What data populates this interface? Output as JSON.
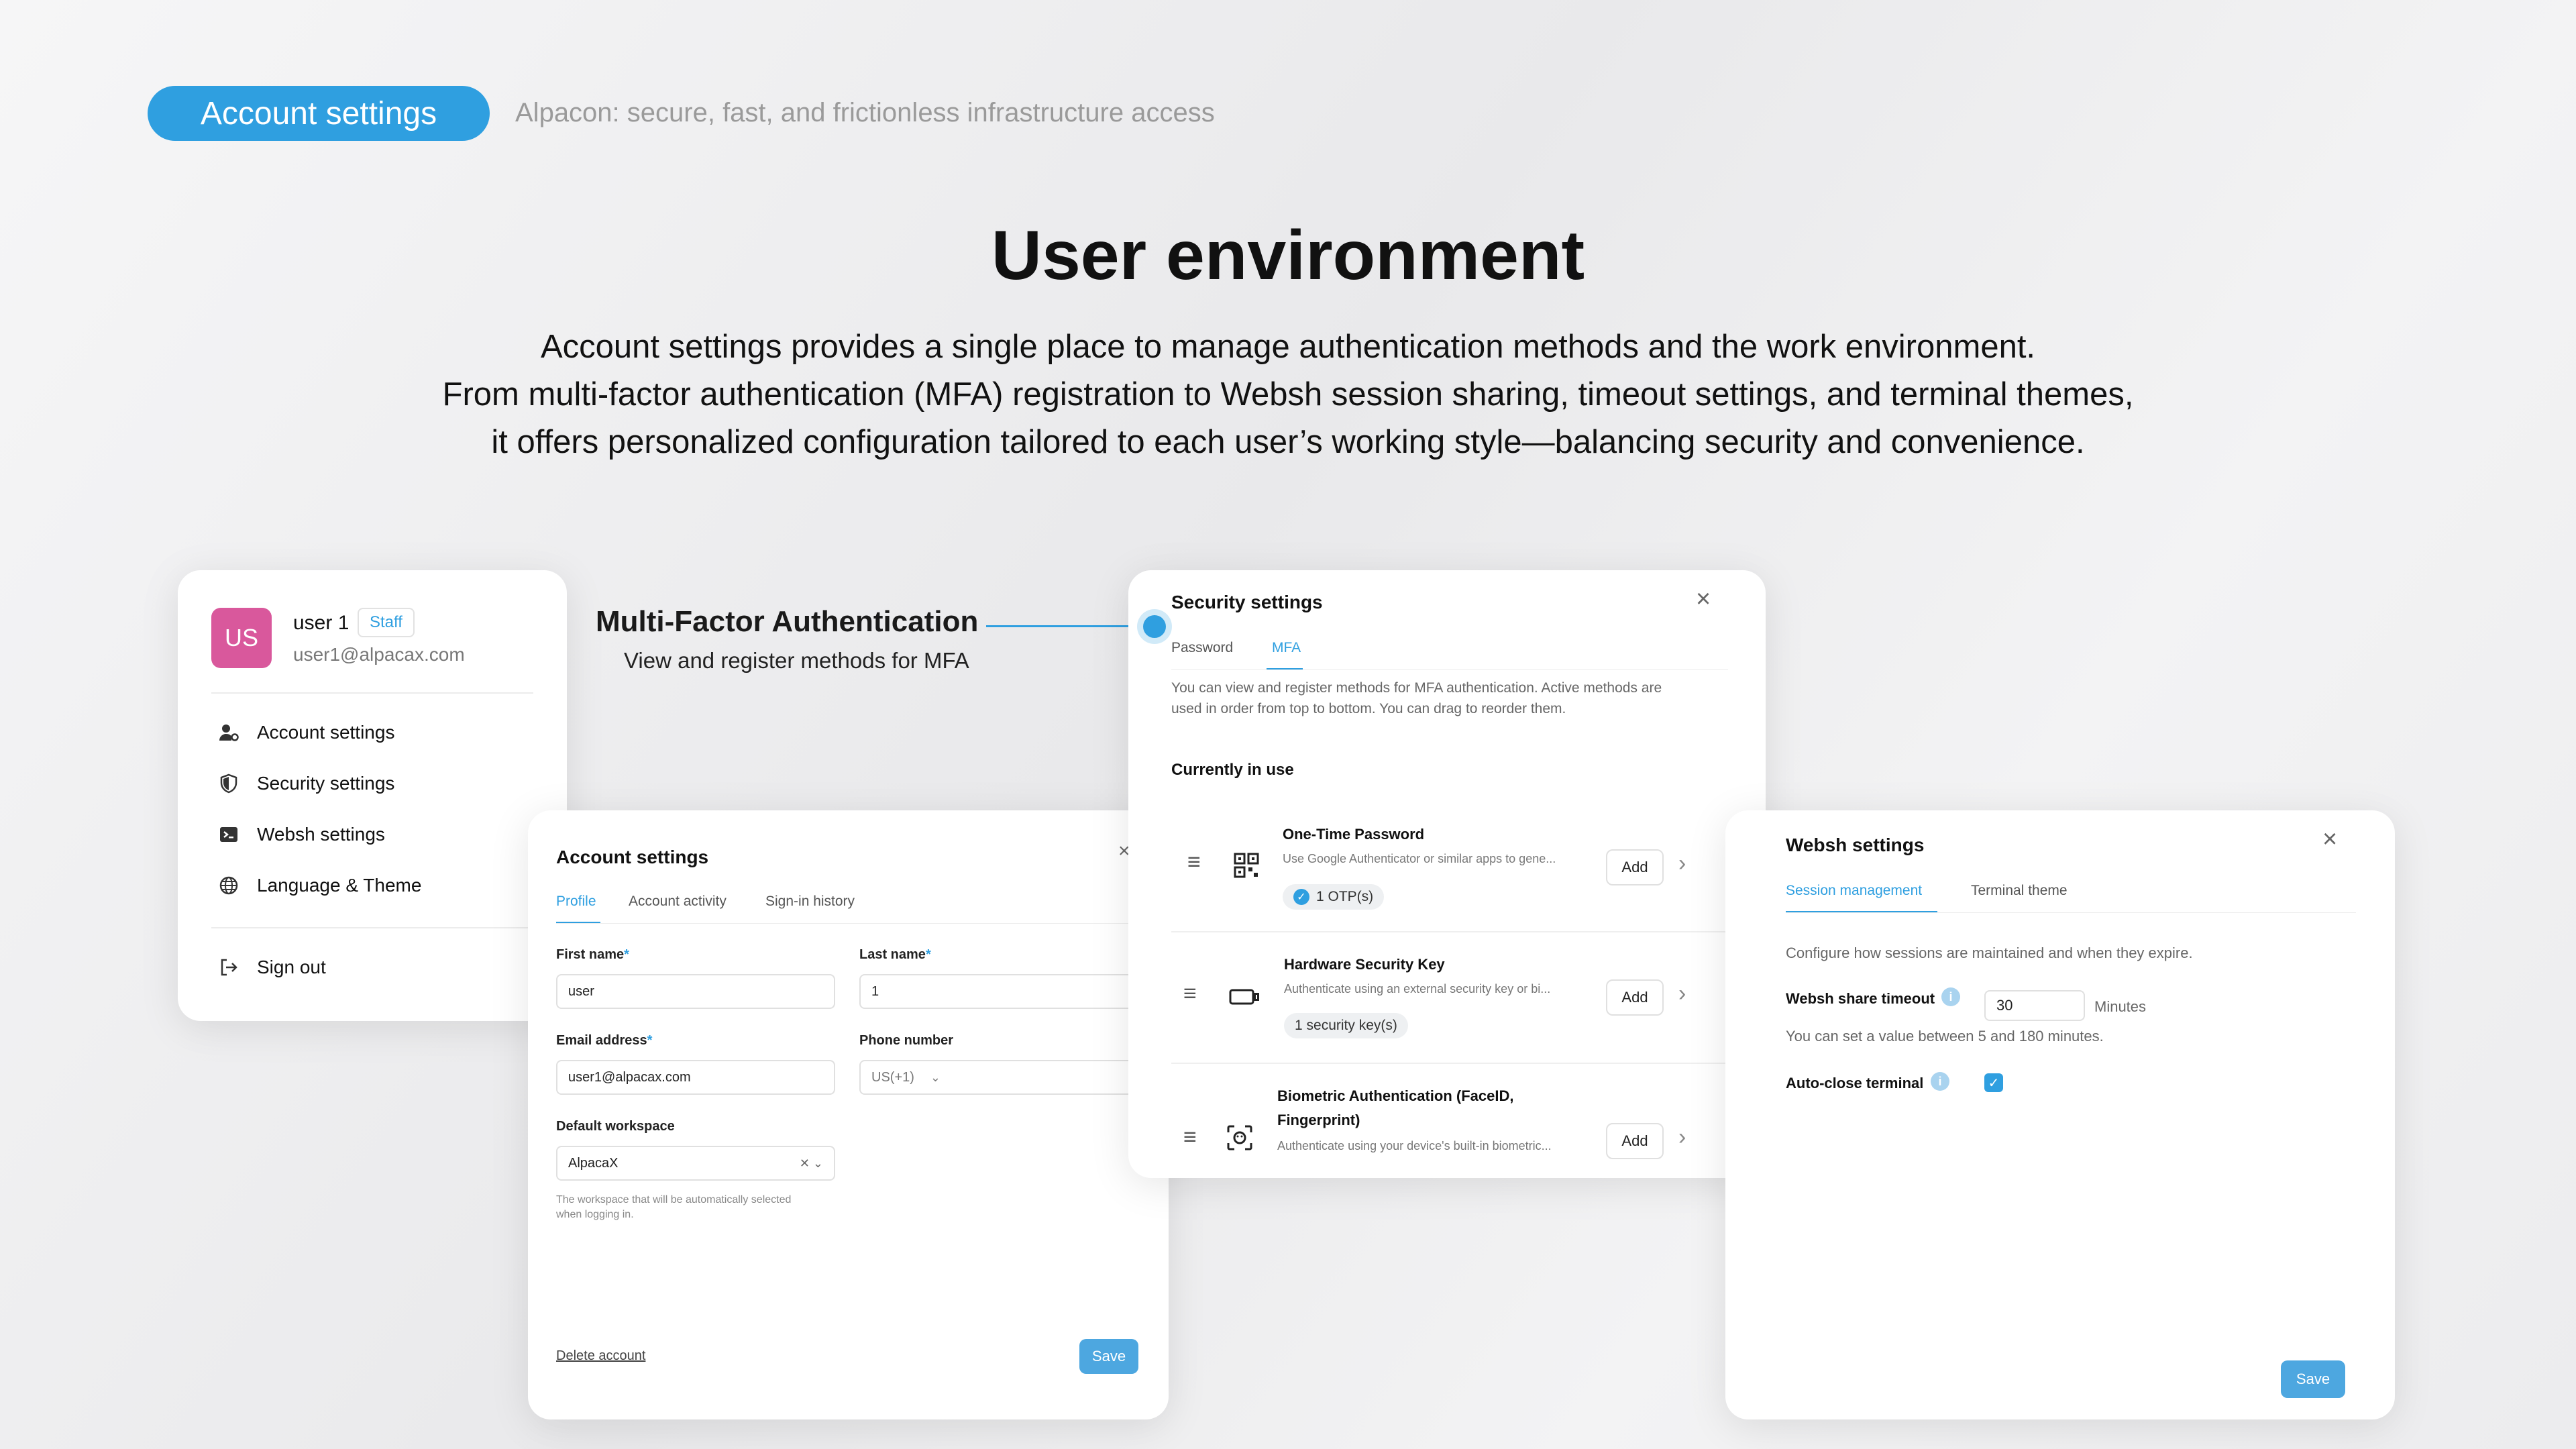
{
  "header": {
    "pill_label": "Account settings",
    "tagline": "Alpacon: secure, fast, and frictionless infrastructure access"
  },
  "hero": {
    "title": "User environment",
    "lines": [
      "Account settings provides a single place to manage authentication methods and the work environment.",
      "From multi-factor authentication (MFA) registration to Websh session sharing, timeout settings, and terminal themes,",
      "it offers personalized configuration tailored to each user’s working style—balancing security and convenience."
    ]
  },
  "user_card": {
    "avatar": "US",
    "name": "user 1",
    "role_badge": "Staff",
    "email": "user1@alpacax.com",
    "menu": [
      {
        "label": "Account settings",
        "icon": "user-gear-icon"
      },
      {
        "label": "Security settings",
        "icon": "shield-icon"
      },
      {
        "label": "Websh settings",
        "icon": "terminal-icon"
      },
      {
        "label": "Language & Theme",
        "icon": "globe-icon"
      }
    ],
    "sign_out": "Sign out"
  },
  "callout": {
    "title": "Multi-Factor Authentication",
    "subtitle": "View and register methods for MFA"
  },
  "account_settings": {
    "title": "Account settings",
    "tabs": [
      "Profile",
      "Account activity",
      "Sign-in history"
    ],
    "active_tab": "Profile",
    "first_name_label": "First name",
    "first_name_value": "user",
    "last_name_label": "Last name",
    "last_name_value": "1",
    "email_label": "Email address",
    "email_value": "user1@alpacax.com",
    "phone_label": "Phone number",
    "phone_country": "US(+1)",
    "workspace_label": "Default workspace",
    "workspace_value": "AlpacaX",
    "workspace_help_1": "The workspace that will be automatically selected",
    "workspace_help_2": "when logging in.",
    "delete_link": "Delete account",
    "save": "Save",
    "required_mark": "*"
  },
  "security_settings": {
    "title": "Security settings",
    "tabs": [
      "Password",
      "MFA"
    ],
    "active_tab": "MFA",
    "info_1": "You can view and register methods for MFA authentication. Active methods are",
    "info_2": "used in order from top to bottom. You can drag to reorder them.",
    "section_title": "Currently in use",
    "methods": [
      {
        "title": "One-Time Password",
        "desc": "Use Google Authenticator or similar apps to gene...",
        "chip": "1 OTP(s)",
        "chip_check": true,
        "add": "Add",
        "icon": "qr-code-icon"
      },
      {
        "title": "Hardware Security Key",
        "desc": "Authenticate using an external security key or bi...",
        "chip": "1 security key(s)",
        "chip_check": false,
        "add": "Add",
        "icon": "security-key-icon"
      },
      {
        "title_1": "Biometric Authentication (FaceID,",
        "title_2": "Fingerprint)",
        "desc": "Authenticate using your device's built-in biometric...",
        "add": "Add",
        "icon": "face-scan-icon"
      }
    ]
  },
  "websh_settings": {
    "title": "Websh settings",
    "tabs": [
      "Session management",
      "Terminal theme"
    ],
    "active_tab": "Session management",
    "description": "Configure how sessions are maintained and when they expire.",
    "timeout_label": "Websh share timeout",
    "timeout_value": "30",
    "timeout_unit": "Minutes",
    "timeout_help": "You can set a value between 5 and 180 minutes.",
    "autoclose_label": "Auto-close terminal",
    "autoclose_checked": true,
    "save": "Save"
  },
  "colors": {
    "accent": "#2f9fe0",
    "avatar": "#d9589c",
    "save_button": "#4da7e0"
  }
}
